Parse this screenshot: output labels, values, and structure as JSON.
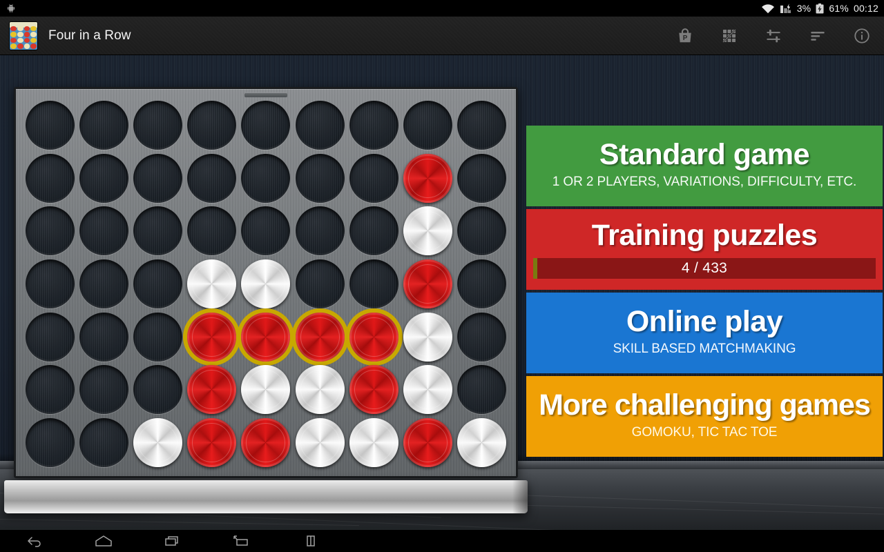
{
  "status_bar": {
    "robot_icon": "android-robot-icon",
    "wifi_icon": "wifi-icon",
    "signal_icon": "cell-signal-icon",
    "signal_text": "3%",
    "battery_icon": "battery-charging-icon",
    "battery_text": "61%",
    "clock": "00:12"
  },
  "action_bar": {
    "app_icon": "four-in-a-row-app-icon",
    "title": "Four in a Row",
    "actions": [
      {
        "name": "shop-bag-icon",
        "label": "Shop"
      },
      {
        "name": "puzzle-grid-icon",
        "label": "Puzzles"
      },
      {
        "name": "sliders-settings-icon",
        "label": "Settings"
      },
      {
        "name": "sort-list-icon",
        "label": "Stats"
      },
      {
        "name": "info-circle-icon",
        "label": "Info"
      }
    ]
  },
  "menu": {
    "cards": [
      {
        "id": "standard",
        "title": "Standard game",
        "subtitle": "1 OR 2 PLAYERS, VARIATIONS, DIFFICULTY, ETC.",
        "color": "#429b40"
      },
      {
        "id": "training",
        "title": "Training puzzles",
        "color": "#cf2727",
        "progress": {
          "label": "4 / 433",
          "solved": 4,
          "total": 433,
          "percent": 1,
          "fill_color": "#7a7a10"
        }
      },
      {
        "id": "online",
        "title": "Online play",
        "subtitle": "SKILL BASED MATCHMAKING",
        "color": "#1a76d2"
      },
      {
        "id": "more",
        "title": "More challenging games",
        "subtitle": "GOMOKU, TIC TAC TOE",
        "color": "#f0a005"
      }
    ]
  },
  "board": {
    "columns": 9,
    "rows": 7,
    "legend": {
      "e": "empty",
      "r": "red",
      "w": "white",
      "R": "red-winning",
      "W": "white-winning"
    },
    "cells": [
      [
        "e",
        "e",
        "e",
        "e",
        "e",
        "e",
        "e",
        "e",
        "e"
      ],
      [
        "e",
        "e",
        "e",
        "e",
        "e",
        "e",
        "e",
        "r",
        "e"
      ],
      [
        "e",
        "e",
        "e",
        "e",
        "e",
        "e",
        "e",
        "w",
        "e"
      ],
      [
        "e",
        "e",
        "e",
        "w",
        "w",
        "e",
        "e",
        "r",
        "e"
      ],
      [
        "e",
        "e",
        "e",
        "R",
        "R",
        "R",
        "R",
        "w",
        "e"
      ],
      [
        "e",
        "e",
        "e",
        "r",
        "w",
        "w",
        "r",
        "w",
        "e"
      ],
      [
        "e",
        "e",
        "w",
        "r",
        "r",
        "w",
        "w",
        "r",
        "w"
      ]
    ]
  },
  "nav_bar": {
    "buttons": [
      {
        "name": "back-icon",
        "label": "Back"
      },
      {
        "name": "home-icon",
        "label": "Home"
      },
      {
        "name": "recents-icon",
        "label": "Recent apps"
      },
      {
        "name": "screenshot-popup-icon",
        "label": "Pop-up view"
      },
      {
        "name": "multiwindow-icon",
        "label": "Multi window"
      }
    ]
  }
}
